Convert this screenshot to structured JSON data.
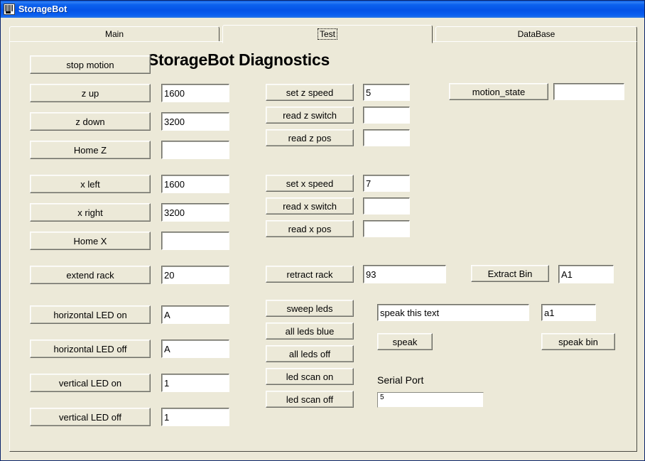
{
  "window": {
    "title": "StorageBot",
    "icon": "storage-grid-icon"
  },
  "tabs": [
    {
      "label": "Main",
      "selected": false
    },
    {
      "label": "Test",
      "selected": true
    },
    {
      "label": "DataBase",
      "selected": false
    }
  ],
  "panel": {
    "heading": "StorageBot Diagnostics"
  },
  "controls": {
    "stop_motion": {
      "label": "stop motion"
    },
    "z_up": {
      "label": "z up",
      "value": "1600"
    },
    "z_down": {
      "label": "z down",
      "value": "3200"
    },
    "home_z": {
      "label": "Home Z",
      "value": ""
    },
    "x_left": {
      "label": "x left",
      "value": "1600"
    },
    "x_right": {
      "label": "x right",
      "value": "3200"
    },
    "home_x": {
      "label": "Home X",
      "value": ""
    },
    "set_z_speed": {
      "label": "set z speed",
      "value": "5"
    },
    "read_z_switch": {
      "label": "read z switch",
      "value": ""
    },
    "read_z_pos": {
      "label": "read z pos",
      "value": ""
    },
    "set_x_speed": {
      "label": "set x speed",
      "value": "7"
    },
    "read_x_switch": {
      "label": "read x switch",
      "value": ""
    },
    "read_x_pos": {
      "label": "read x pos",
      "value": ""
    },
    "motion_state": {
      "label": "motion_state",
      "value": ""
    },
    "extend_rack": {
      "label": "extend rack",
      "value": "20"
    },
    "retract_rack": {
      "label": "retract rack",
      "value": "93"
    },
    "extract_bin": {
      "label": "Extract Bin",
      "value": "A1"
    },
    "horizontal_led_on": {
      "label": "horizontal LED on",
      "value": "A"
    },
    "horizontal_led_off": {
      "label": "horizontal LED off",
      "value": "A"
    },
    "vertical_led_on": {
      "label": "vertical LED on",
      "value": "1"
    },
    "vertical_led_off": {
      "label": "vertical LED off",
      "value": "1"
    },
    "sweep_leds": {
      "label": "sweep leds"
    },
    "all_leds_blue": {
      "label": "all leds blue"
    },
    "all_leds_off": {
      "label": "all leds off"
    },
    "led_scan_on": {
      "label": "led scan on"
    },
    "led_scan_off": {
      "label": "led scan off"
    },
    "speak_text": {
      "value": "speak this text"
    },
    "speak": {
      "label": "speak"
    },
    "speak_bin_value": {
      "value": "a1"
    },
    "speak_bin": {
      "label": "speak bin"
    },
    "serial_port": {
      "label": "Serial Port",
      "value": "5"
    }
  },
  "colors": {
    "face": "#ece9d8",
    "title_bar_blue": "#0a5ae0",
    "field_bg": "#ffffff",
    "text": "#000000"
  }
}
